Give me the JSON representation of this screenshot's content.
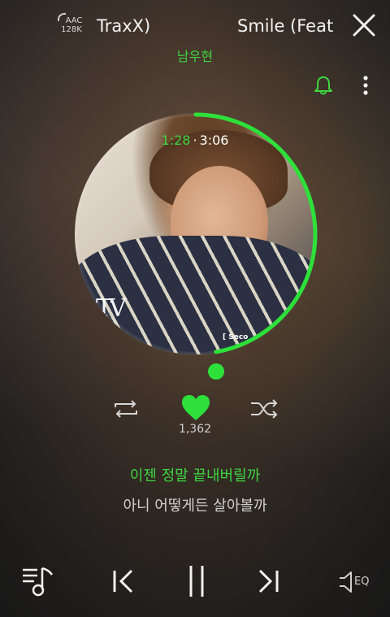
{
  "header": {
    "quality_top": "AAC",
    "quality_bottom": "128K",
    "title_scroll_tail": "TraxX)",
    "title_scroll_head": "Smile (Feat"
  },
  "artist": "남우현",
  "player": {
    "current_time": "1:28",
    "separator": "·",
    "total_time": "3:06",
    "progress": 0.473,
    "like_count": "1,362"
  },
  "album_art": {
    "logo_text": "TV",
    "corner_text": "[ Seco"
  },
  "lyrics": {
    "current": "이젠 정말 끝내버릴까",
    "next": "아니 어떻게든 살아볼까"
  },
  "controls": {
    "eq_label": "EQ"
  },
  "icons": {
    "close": "close-icon",
    "bell": "bell-icon",
    "more": "more-vertical-icon",
    "repeat": "repeat-icon",
    "like": "heart-icon",
    "shuffle": "shuffle-icon",
    "playlist": "playlist-icon",
    "prev": "skip-previous-icon",
    "pause": "pause-icon",
    "next": "skip-next-icon",
    "eq": "speaker-eq-icon"
  },
  "colors": {
    "accent": "#3ed540",
    "text_light": "#f2f2f2",
    "text_muted": "#cfcfcf"
  }
}
